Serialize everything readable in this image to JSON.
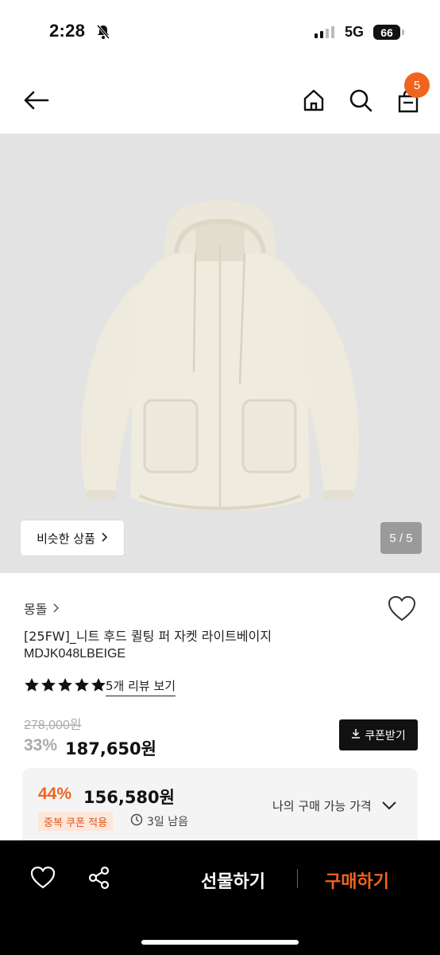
{
  "status_bar": {
    "time": "2:28",
    "network": "5G",
    "battery": "66"
  },
  "header": {
    "cart_count": "5"
  },
  "gallery": {
    "similar_label": "비슷한 상품",
    "counter": "5 / 5"
  },
  "product": {
    "brand": "몽돌",
    "title_line1": "[25FW]_니트 후드 퀼팅 퍼 자켓 라이트베이지",
    "title_line2": "MDJK048LBEIGE",
    "rating_stars": 5,
    "review_link": "5개 리뷰 보기",
    "original_price": "278,000원",
    "discount_rate": "33%",
    "sale_price": "187,650원",
    "coupon_button": "쿠폰받기"
  },
  "coupon_box": {
    "discount_rate": "44%",
    "price": "156,580원",
    "tag": "중복 쿠폰 적용",
    "time_left": "3일 남음",
    "my_price_label": "나의 구매 가능 가격"
  },
  "bottom_bar": {
    "gift_label": "선물하기",
    "buy_label": "구매하기"
  },
  "colors": {
    "accent": "#f0641e",
    "bottom_bar": "#000000",
    "image_bg": "#e3e3e3"
  }
}
